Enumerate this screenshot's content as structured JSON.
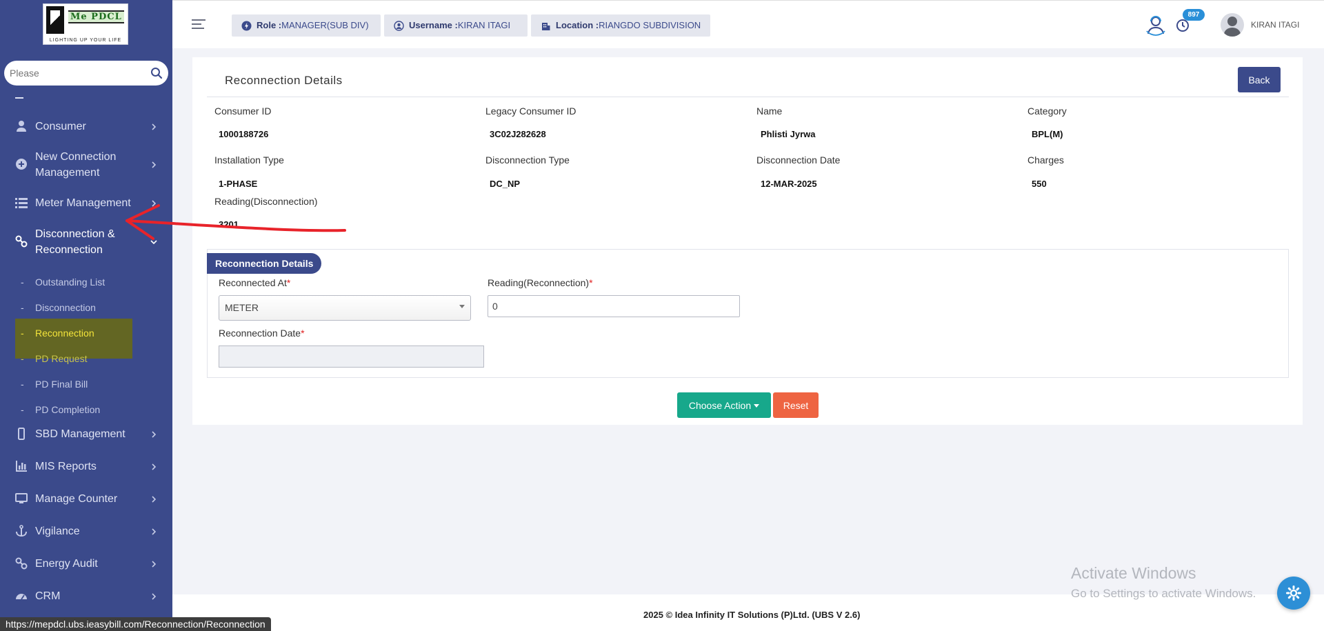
{
  "logo": {
    "title": "Me PDCL",
    "tagline": "LIGHTING UP YOUR LIFE"
  },
  "sidebar": {
    "search_placeholder": "Please",
    "items": [
      {
        "label": "Consumer",
        "icon": "user-icon"
      },
      {
        "label": "New Connection Management",
        "icon": "plus-circle-icon"
      },
      {
        "label": "Meter Management",
        "icon": "list-icon"
      },
      {
        "label": "Disconnection & Reconnection",
        "icon": "link-icon"
      },
      {
        "label": "SBD Management",
        "icon": "mobile-icon"
      },
      {
        "label": "MIS Reports",
        "icon": "bar-chart-icon"
      },
      {
        "label": "Manage Counter",
        "icon": "monitor-icon"
      },
      {
        "label": "Vigilance",
        "icon": "anchor-icon"
      },
      {
        "label": "Energy Audit",
        "icon": "link-icon"
      },
      {
        "label": "CRM",
        "icon": "dashboard-icon"
      }
    ],
    "subitems": [
      {
        "label": "Outstanding List"
      },
      {
        "label": "Disconnection"
      },
      {
        "label": "Reconnection"
      },
      {
        "label": "PD Request"
      },
      {
        "label": "PD Final Bill"
      },
      {
        "label": "PD Completion"
      }
    ]
  },
  "header": {
    "role_label": "Role :",
    "role_value": "MANAGER(SUB DIV)",
    "username_label": "Username :",
    "username_value": "KIRAN ITAGI",
    "location_label": "Location :",
    "location_value": "RIANGDO SUBDIVISION",
    "notification_count": "897",
    "user_name": "KIRAN ITAGI"
  },
  "page": {
    "title": "Reconnection Details",
    "back_label": "Back",
    "fields": [
      {
        "label": "Consumer ID",
        "value": "1000188726"
      },
      {
        "label": "Legacy Consumer ID",
        "value": "3C02J282628"
      },
      {
        "label": "Name",
        "value": "Phlisti Jyrwa"
      },
      {
        "label": "Category",
        "value": "BPL(M)"
      },
      {
        "label": "Installation Type",
        "value": "1-PHASE"
      },
      {
        "label": "Disconnection Type",
        "value": "DC_NP"
      },
      {
        "label": "Disconnection Date",
        "value": "12-MAR-2025"
      },
      {
        "label": "Charges",
        "value": "550"
      },
      {
        "label": "Reading(Disconnection)",
        "value": "3201"
      }
    ],
    "section_title": "Reconnection Details",
    "reconnected_at_label": "Reconnected At",
    "reconnected_at_value": "METER",
    "reading_label": "Reading(Reconnection)",
    "reading_value": "0",
    "date_label": "Reconnection Date",
    "date_value": "",
    "required_mark": "*",
    "choose_action_label": "Choose Action",
    "reset_label": "Reset"
  },
  "footer": {
    "text": "2025 © Idea Infinity IT Solutions (P)Ltd. (UBS V 2.6)"
  },
  "status_bar": {
    "url": "https://mepdcl.ubs.ieasybill.com/Reconnection/Reconnection"
  },
  "watermark": {
    "line1": "Activate Windows",
    "line2": "Go to Settings to activate Windows."
  },
  "colors": {
    "sidebar": "#3b4a8b",
    "accent_green": "#17a88b",
    "accent_orange": "#ee6442",
    "badge": "#2a8fd8"
  }
}
